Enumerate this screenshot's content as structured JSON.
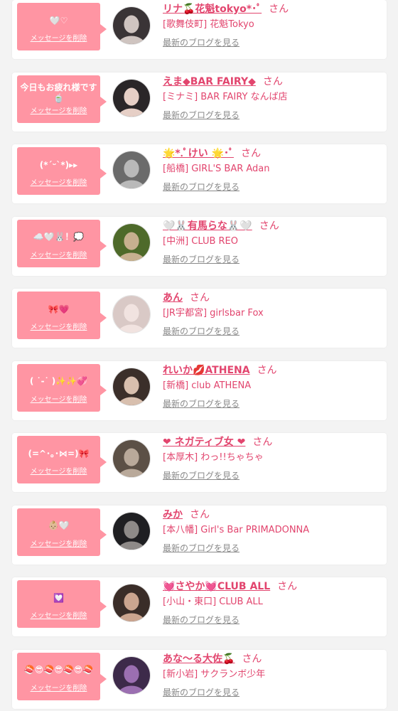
{
  "theme": {
    "accent": "#e2456e",
    "bubble": "#ff95a3",
    "link_gray": "#8a8a8a",
    "background": "#f3f3f3"
  },
  "labels": {
    "delete_message": "メッセージを削除",
    "honorific": "さん",
    "latest_blog": "最新のブログを見る"
  },
  "items": [
    {
      "message": "🤍♡",
      "name": "リナ🍒花魁tokyo*･ﾟ",
      "shop": "[歌舞伎町] 花魁Tokyo",
      "avatar_colors": [
        "#3a3436",
        "#cfc4c0"
      ]
    },
    {
      "message": "今日もお疲れ様です🍵",
      "name": "えま◆BAR FAIRY◆",
      "shop": "[ミナミ] BAR FAIRY なんば店",
      "avatar_colors": [
        "#2a2628",
        "#e6cfc6"
      ]
    },
    {
      "message": "(*ˊᵕˋ*)▸▸",
      "name": "🌟*.ﾟけい 🌟･ﾟ",
      "shop": "[船橋] GIRL'S BAR Adan",
      "avatar_colors": [
        "#6b6b6b",
        "#b9b9b9"
      ]
    },
    {
      "message": "☁️🤍🐰！💭",
      "name": "🤍🐰有馬らな🐰🤍",
      "shop": "[中洲] CLUB REO",
      "avatar_colors": [
        "#4e6a2a",
        "#c7b08f"
      ]
    },
    {
      "message": "🎀💗",
      "name": "あん",
      "shop": "[JR宇都宮] girlsbar Fox",
      "avatar_colors": [
        "#d9c9c6",
        "#f1e3e0"
      ]
    },
    {
      "message": "( ˙-˙ )✨✨💞",
      "name": "れいか💋ATHENA",
      "shop": "[新橋] club ATHENA",
      "avatar_colors": [
        "#3b2f2a",
        "#d8bfae"
      ]
    },
    {
      "message": "(=^･｡･⋈=)🎀",
      "name": "❤ ネガティブ女 ❤",
      "shop": "[本厚木] わっ!!ちゃちゃ",
      "avatar_colors": [
        "#5c5046",
        "#b9a99a"
      ]
    },
    {
      "message": "👶🏼🤍",
      "name": "みか",
      "shop": "[本八幡] Girl's Bar PRIMADONNA",
      "avatar_colors": [
        "#1f1f22",
        "#8e8a88"
      ]
    },
    {
      "message": "💟",
      "name": "💓さやか💓CLUB ALL",
      "shop": "[小山・東口] CLUB ALL",
      "avatar_colors": [
        "#3a2d28",
        "#cba58f"
      ]
    },
    {
      "message": "🍣😎🍣😎🍣😎🍣",
      "name": "あな～る大佐🍒",
      "shop": "[新小岩] サクランボ少年",
      "avatar_colors": [
        "#3d2a4a",
        "#9b6fb1"
      ]
    }
  ]
}
